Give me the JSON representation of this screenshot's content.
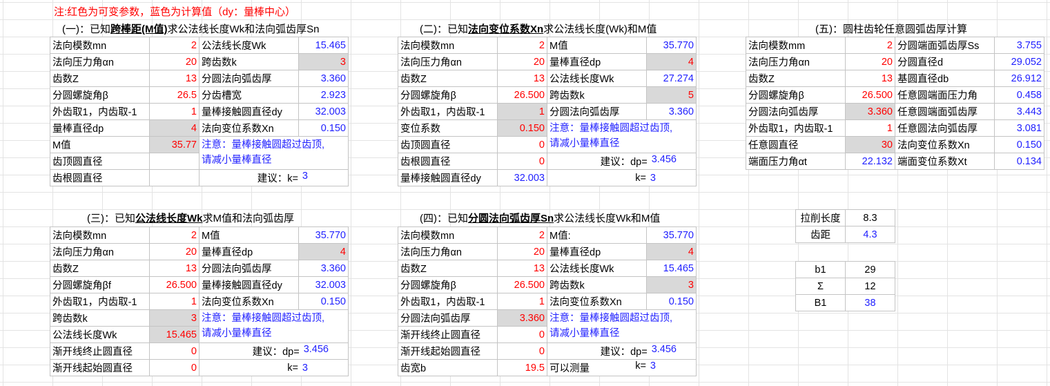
{
  "note": "注:红色为可变参数，蓝色为计算值（dy：量棒中心）",
  "t1": {
    "title_pre": "(一)：已知",
    "title_bold": "跨棒距(M值)",
    "title_post": "求公法线长度Wk和法向弧齿厚Sn",
    "rows": [
      [
        "法向模数mn",
        "2",
        "公法线长度Wk",
        "15.465"
      ],
      [
        "法向压力角αn",
        "20",
        "跨齿数k",
        "3"
      ],
      [
        "齿数Z",
        "13",
        "分圆法向弧齿厚",
        "3.360"
      ],
      [
        "分圆螺旋角β",
        "26.5",
        "分齿槽宽",
        "2.923"
      ],
      [
        "外齿取1，内齿取-1",
        "1",
        "量棒接触圆直径dy",
        "32.003"
      ],
      [
        "量棒直径dp",
        "4",
        "法向变位系数Xn",
        "0.150"
      ],
      [
        "M值",
        "35.77"
      ],
      [
        "齿顶圆直径",
        ""
      ],
      [
        "齿根圆直径",
        ""
      ]
    ],
    "note1": "注意：量棒接触圆超过齿顶,",
    "note2": "请减小量棒直径",
    "suggest_label": "建议：k=",
    "suggest_value": "3"
  },
  "t2": {
    "title_pre": "(二)：已知",
    "title_bold": "法向变位系数Xn",
    "title_post": "求公法线长度(Wk)和M值",
    "rows": [
      [
        "法向模数mn",
        "2",
        "M值",
        "35.770"
      ],
      [
        "法向压力角αn",
        "20",
        "量棒直径dp",
        "4"
      ],
      [
        "齿数Z",
        "13",
        "公法线长度Wk",
        "27.274"
      ],
      [
        "分圆螺旋角β",
        "26.500",
        "跨齿数k",
        "5"
      ],
      [
        "外齿取1，内齿取-1",
        "1",
        "分圆法向弧齿厚",
        "3.360"
      ],
      [
        "变位系数",
        "0.150"
      ],
      [
        "齿顶圆直径",
        "0"
      ],
      [
        "齿根圆直径",
        "0"
      ],
      [
        "量棒接触圆直径dy",
        "32.003"
      ]
    ],
    "note1": "注意：量棒接触圆超过齿顶,",
    "note2": "请减小量棒直径",
    "suggest_label": "建议：dp=",
    "suggest_value": "3.456",
    "k_label": "k=",
    "k_value": "3"
  },
  "t3": {
    "title_pre": "(三)：已知",
    "title_bold": "公法线长度Wk",
    "title_post": "求M值和法向弧齿厚",
    "rows": [
      [
        "法向模数mn",
        "2",
        "M值",
        "35.770"
      ],
      [
        "法向压力角αn",
        "20",
        "量棒直径dp",
        "4"
      ],
      [
        "齿数Z",
        "13",
        "分圆法向弧齿厚",
        "3.360"
      ],
      [
        "分圆螺旋角βf",
        "26.500",
        "量棒接触圆直径dy",
        "32.003"
      ],
      [
        "外齿取1，内齿取-1",
        "1",
        "法向变位系数Xn",
        "0.150"
      ],
      [
        "跨齿数k",
        "3"
      ],
      [
        "公法线长度Wk",
        "15.465"
      ],
      [
        "渐开线终止圆直径",
        "0"
      ],
      [
        "渐开线起始圆直径",
        "0"
      ]
    ],
    "note1": "注意：量棒接触圆超过齿顶,",
    "note2": "请减小量棒直径",
    "suggest_label": "建议：dp=",
    "suggest_value": "3.456",
    "k_label": "k=",
    "k_value": "3"
  },
  "t4": {
    "title_pre": "(四)：已知",
    "title_bold": "分圆法向弧齿厚Sn",
    "title_post": "求公法线长度Wk和M值",
    "rows": [
      [
        "法向模数mn",
        "2",
        "M值:",
        "35.770"
      ],
      [
        "法向压力角αn",
        "20",
        "量棒直径dp",
        "4"
      ],
      [
        "齿数Z",
        "13",
        "公法线长度Wk",
        "15.465"
      ],
      [
        "分圆螺旋角β",
        "26.500",
        "跨齿数k",
        "3"
      ],
      [
        "外齿取1，内齿取-1",
        "1",
        "法向变位系数Xn",
        "0.150"
      ],
      [
        "分圆法向弧齿厚",
        "3.360"
      ],
      [
        "渐开线终止圆直径",
        "0"
      ],
      [
        "渐开线起始圆直径",
        "0"
      ],
      [
        "齿宽b",
        "19.5",
        "可以测量"
      ]
    ],
    "note1": "注意：量棒接触圆超过齿顶,",
    "note2": "请减小量棒直径",
    "suggest_label": "建议：dp=",
    "suggest_value": "3.456",
    "k_label": "k=",
    "k_value": "3"
  },
  "t5": {
    "title": "(五)：圆柱齿轮任意圆弧齿厚计算",
    "rows": [
      [
        "法向模数mm",
        "2",
        "分圆端面弧齿厚Ss",
        "3.755"
      ],
      [
        "法向压力角αn",
        "20",
        "分圆直径d",
        "29.052"
      ],
      [
        "齿数Z",
        "13",
        "基圆直径db",
        "26.912"
      ],
      [
        "分圆螺旋角β",
        "26.500",
        "任意圆端面压力角",
        "0.458"
      ],
      [
        "分圆法向弧齿厚",
        "3.360",
        "任意圆端面弧齿厚",
        "3.443"
      ],
      [
        "外齿取1，内齿取-1",
        "1",
        "任意圆法向弧齿厚",
        "3.081"
      ],
      [
        "任意圆直径",
        "30",
        "法向变位系数Xn",
        "0.150"
      ],
      [
        "端面压力角αt",
        "22.132",
        "端面变位系数Xt",
        "0.134"
      ]
    ]
  },
  "t6": {
    "rows": [
      [
        "拉削长度",
        "8.3"
      ],
      [
        "齿距",
        "4.3"
      ]
    ]
  },
  "t7": {
    "rows": [
      [
        "b1",
        "29"
      ],
      [
        "Σ",
        "12"
      ],
      [
        "B1",
        "38"
      ]
    ]
  },
  "colors": {
    "input": "#ff0000",
    "calc": "#1f1fff",
    "shade": "#d9d9d9"
  }
}
